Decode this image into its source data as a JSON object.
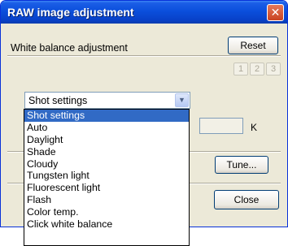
{
  "window": {
    "title": "RAW image adjustment",
    "close_glyph": "✕"
  },
  "white_balance": {
    "label": "White balance adjustment",
    "reset_label": "Reset",
    "number_buttons": [
      "1",
      "2",
      "3"
    ],
    "selected_value": "Shot settings",
    "options": [
      "Shot settings",
      "Auto",
      "Daylight",
      "Shade",
      "Cloudy",
      "Tungsten light",
      "Fluorescent light",
      "Flash",
      "Color temp.",
      "Click white balance"
    ],
    "kelvin_unit": "K",
    "tune_label": "Tune...",
    "close_label": "Close"
  },
  "colors": {
    "titlebar": "#0b4fdc",
    "selection": "#316ac5",
    "dialog_bg": "#ece9d8"
  },
  "icons": [
    "close-icon",
    "chevron-down-icon"
  ]
}
